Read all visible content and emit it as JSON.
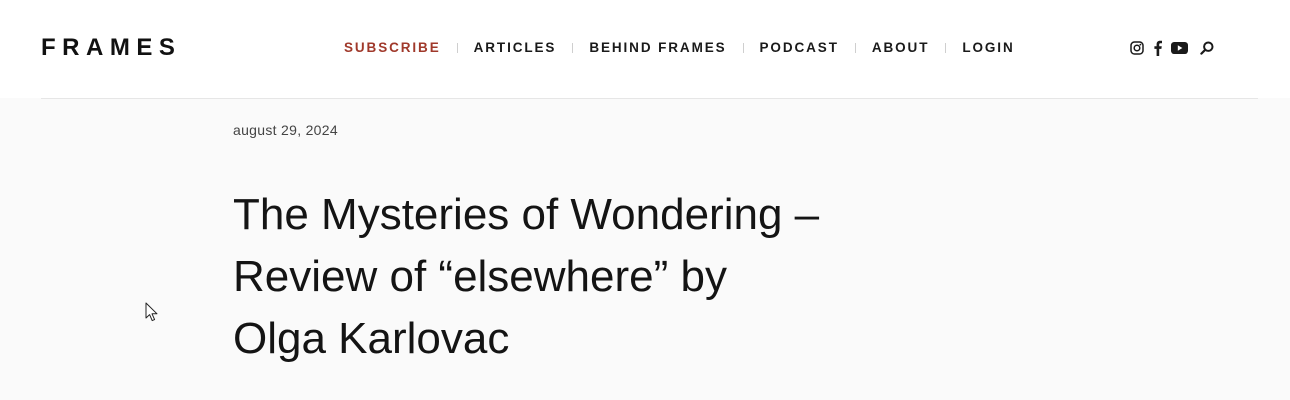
{
  "brand": {
    "logo_text": "FRAMES"
  },
  "nav": {
    "items": [
      {
        "label": "SUBSCRIBE",
        "accent": true
      },
      {
        "label": "ARTICLES"
      },
      {
        "label": "BEHIND FRAMES"
      },
      {
        "label": "PODCAST"
      },
      {
        "label": "ABOUT"
      },
      {
        "label": "LOGIN"
      }
    ]
  },
  "social_icons": [
    "instagram-icon",
    "facebook-icon",
    "youtube-icon",
    "search-icon"
  ],
  "article": {
    "date": "august 29, 2024",
    "title_lines": [
      "The Mysteries of Wondering –",
      "Review of “elsewhere” by",
      "Olga Karlovac"
    ]
  },
  "colors": {
    "accent": "#a0392b",
    "text": "#141414",
    "background": "#fafafa"
  }
}
